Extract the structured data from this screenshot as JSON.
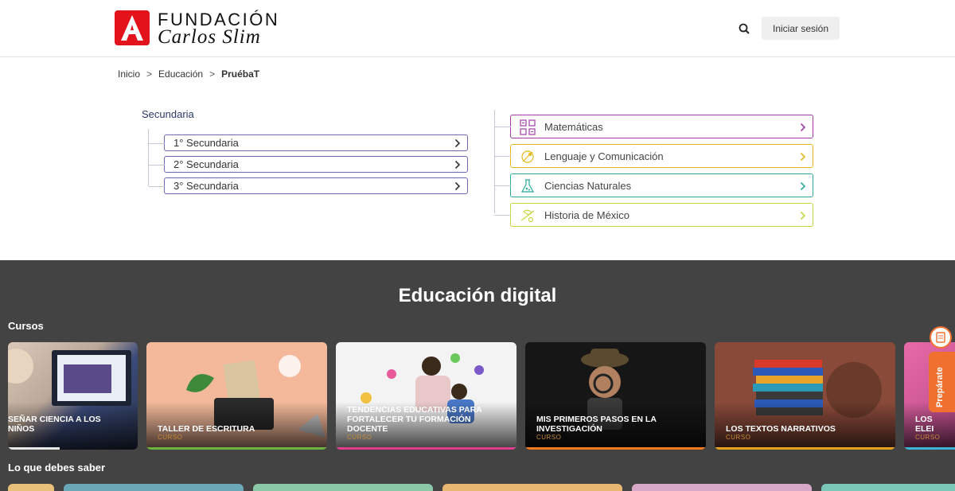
{
  "header": {
    "logo_top": "FUNDACIÓN",
    "logo_bottom": "Carlos Slim",
    "login_label": "Iniciar sesión",
    "brand_color": "#e3131b"
  },
  "breadcrumb": {
    "items": [
      "Inicio",
      "Educación",
      "PruébaT"
    ],
    "separator": ">"
  },
  "levels": {
    "title": "Secundaria",
    "grades": [
      "1° Secundaria",
      "2° Secundaria",
      "3° Secundaria"
    ]
  },
  "subjects": [
    {
      "label": "Matemáticas",
      "color": "#a23ca6",
      "icon": "math-icon"
    },
    {
      "label": "Lenguaje y Comunicación",
      "color": "#e7b81f",
      "icon": "language-icon"
    },
    {
      "label": "Ciencias Naturales",
      "color": "#2ca89a",
      "icon": "science-icon"
    },
    {
      "label": "Historia de México",
      "color": "#c8d640",
      "icon": "history-icon"
    }
  ],
  "digital": {
    "title": "Educación digital",
    "courses_label": "Cursos",
    "know_label": "Lo que debes saber",
    "prep_label": "Prepárate",
    "cards": [
      {
        "title": "SEÑAR CIENCIA A LOS NIÑOS",
        "type": "",
        "bar": "#e8e8e8"
      },
      {
        "title": "TALLER DE ESCRITURA",
        "type": "CURSO",
        "bar": "#6db33f"
      },
      {
        "title": "TENDENCIAS EDUCATIVAS PARA FORTALECER TU FORMACIÓN DOCENTE",
        "type": "CURSO",
        "bar": "#e43c8c"
      },
      {
        "title": "MIS PRIMEROS PASOS EN LA INVESTIGACIÓN",
        "type": "CURSO",
        "bar": "#f07a1c"
      },
      {
        "title": "LOS TEXTOS NARRATIVOS",
        "type": "CURSO",
        "bar": "#e8a41c"
      },
      {
        "title": "LOS ELEI",
        "type": "CURSO",
        "bar": "#3cb4d8"
      }
    ]
  }
}
